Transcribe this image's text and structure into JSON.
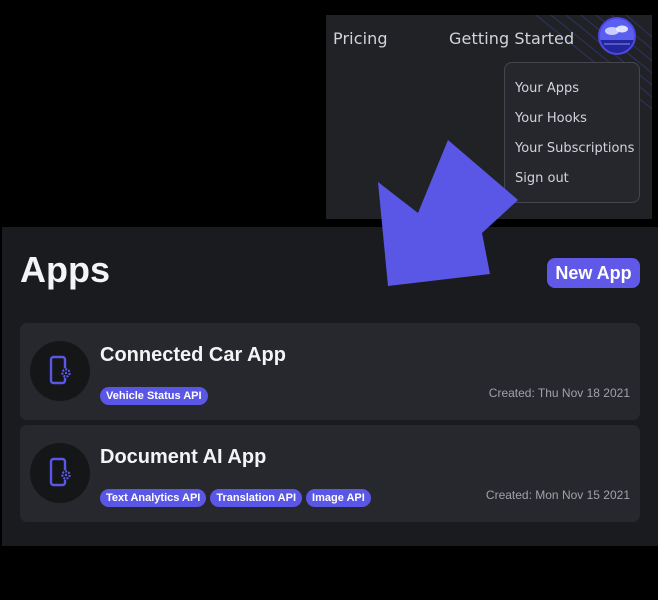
{
  "navbar": {
    "links": [
      "Pricing",
      "Getting Started"
    ],
    "dropdown": [
      "Your Apps",
      "Your Hooks",
      "Your Subscriptions",
      "Sign out"
    ]
  },
  "page": {
    "title": "Apps",
    "new_app_label": "New App"
  },
  "apps": [
    {
      "name": "Connected Car App",
      "tags": [
        "Vehicle Status API"
      ],
      "created": "Created: Thu Nov 18 2021"
    },
    {
      "name": "Document AI App",
      "tags": [
        "Text Analytics API",
        "Translation API",
        "Image API"
      ],
      "created": "Created: Mon Nov 15 2021"
    }
  ],
  "colors": {
    "accent": "#5b57e6",
    "arrow": "#5b57e6",
    "panel_bg": "#1a1b1e",
    "card_bg": "#27282d"
  }
}
